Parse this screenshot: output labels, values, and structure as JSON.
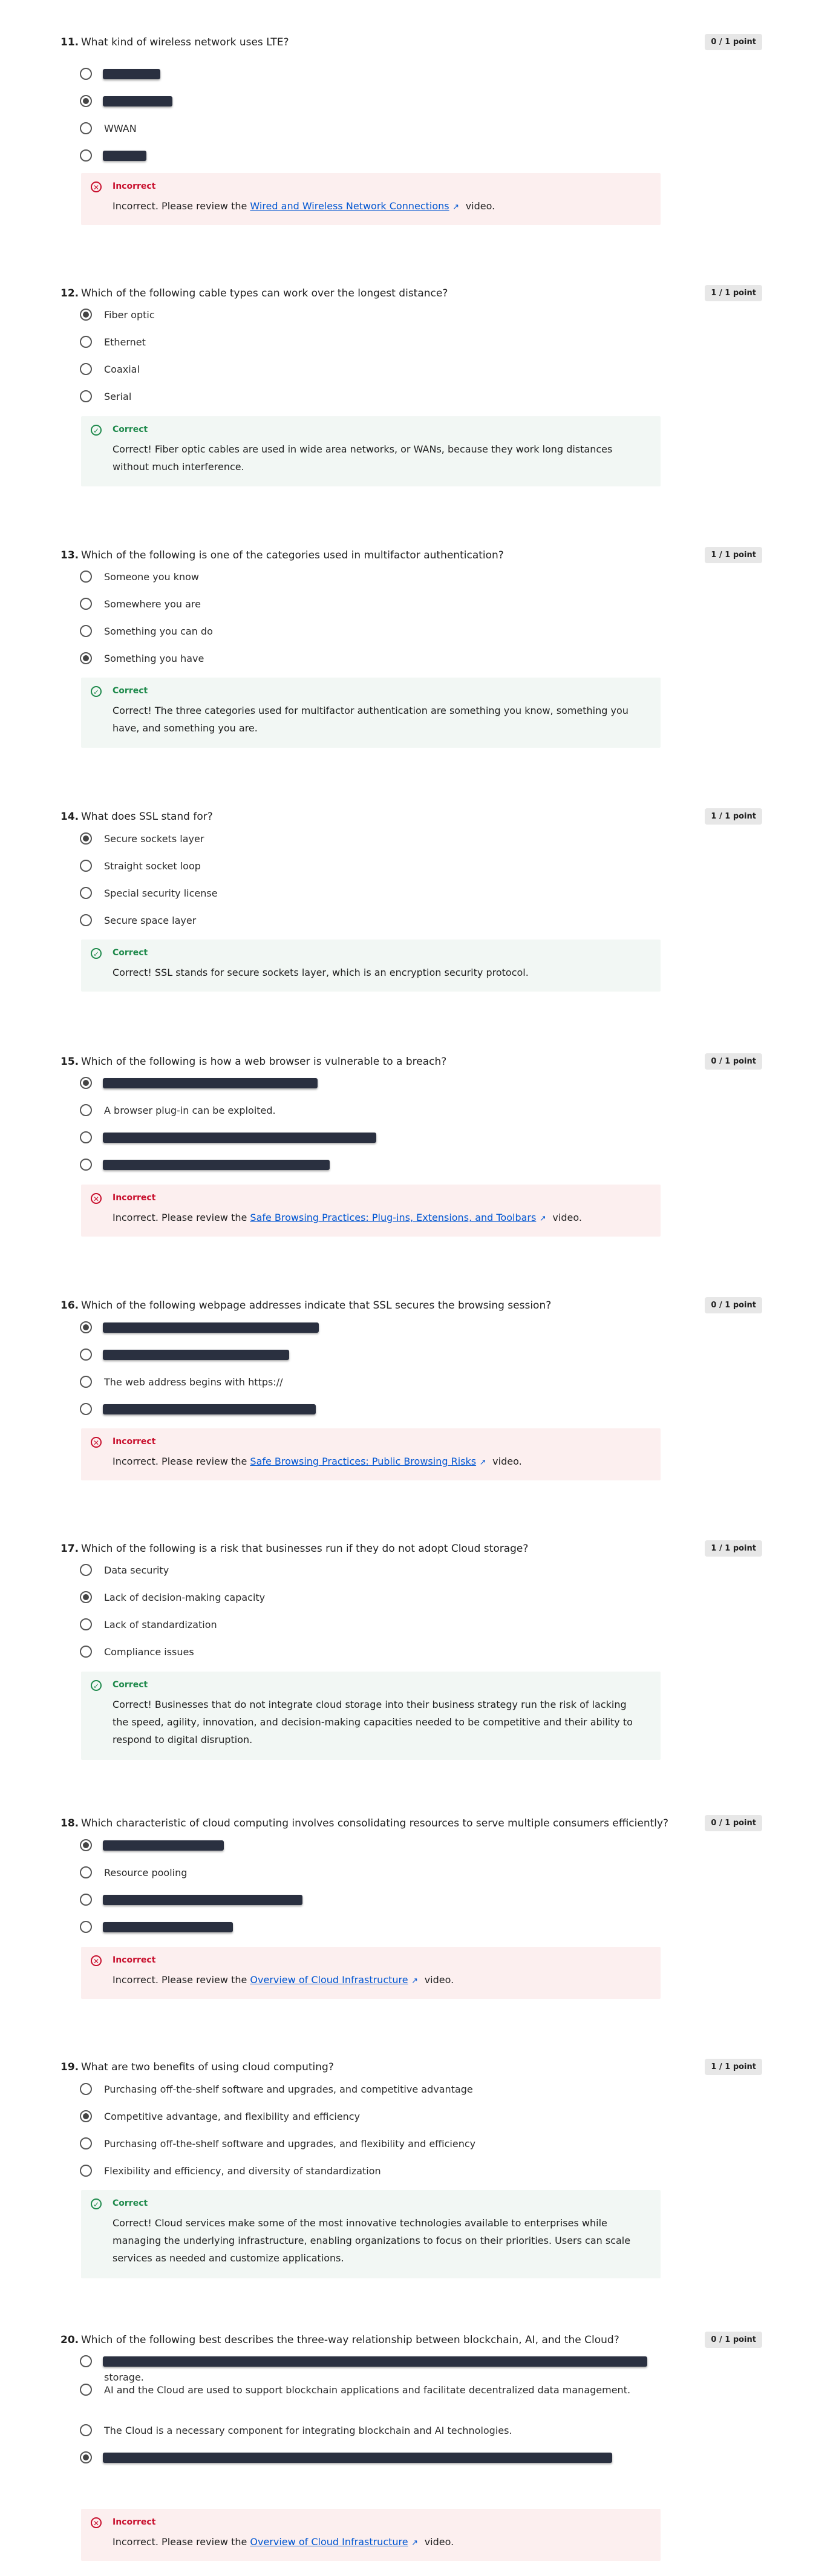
{
  "colors": {
    "incorrect": "#c8102e",
    "correct": "#1f8a4c",
    "link": "#0056d2",
    "score_badge": "#e7e7e7"
  },
  "icons": {
    "incorrect": "x-circle-icon",
    "correct": "check-circle-icon",
    "external": "external-link-icon"
  },
  "questions": [
    {
      "number": "11.",
      "text": "What kind of wireless network uses LTE?",
      "score": "0 / 1 point",
      "options": [
        {
          "text": "",
          "redacted": true,
          "selected": false
        },
        {
          "text": "",
          "redacted": true,
          "selected": true
        },
        {
          "text": "WWAN",
          "redacted": false,
          "selected": false
        },
        {
          "text": "",
          "redacted": true,
          "selected": false
        }
      ],
      "feedback": {
        "status": "Incorrect",
        "before": "Incorrect. Please review the ",
        "link": "Wired and Wireless Network Connections",
        "after": " video.",
        "text": ""
      }
    },
    {
      "number": "12.",
      "text": "Which of the following cable types can work over the longest distance?",
      "score": "1 / 1 point",
      "options": [
        {
          "text": "Fiber optic",
          "redacted": false,
          "selected": true
        },
        {
          "text": "Ethernet",
          "redacted": false,
          "selected": false
        },
        {
          "text": "Coaxial",
          "redacted": false,
          "selected": false
        },
        {
          "text": "Serial",
          "redacted": false,
          "selected": false
        }
      ],
      "feedback": {
        "status": "Correct",
        "text": "Correct! Fiber optic cables are used in wide area networks, or WANs, because they work long distances without much interference."
      }
    },
    {
      "number": "13.",
      "text": "Which of the following is one of the categories used in multifactor authentication?",
      "score": "1 / 1 point",
      "options": [
        {
          "text": "Someone you know",
          "redacted": false,
          "selected": false
        },
        {
          "text": "Somewhere you are",
          "redacted": false,
          "selected": false
        },
        {
          "text": "Something you can do",
          "redacted": false,
          "selected": false
        },
        {
          "text": "Something you have",
          "redacted": false,
          "selected": true
        }
      ],
      "feedback": {
        "status": "Correct",
        "text": "Correct! The three categories used for multifactor authentication are something you know, something you have, and something you are."
      }
    },
    {
      "number": "14.",
      "text": "What does SSL stand for?",
      "score": "1 / 1 point",
      "options": [
        {
          "text": "Secure sockets layer",
          "redacted": false,
          "selected": true
        },
        {
          "text": "Straight socket loop",
          "redacted": false,
          "selected": false
        },
        {
          "text": "Special security license",
          "redacted": false,
          "selected": false
        },
        {
          "text": "Secure space layer",
          "redacted": false,
          "selected": false
        }
      ],
      "feedback": {
        "status": "Correct",
        "text": "Correct! SSL stands for secure sockets layer, which is an encryption security protocol."
      }
    },
    {
      "number": "15.",
      "text": "Which of the following is how a web browser is vulnerable to a breach?",
      "score": "0 / 1 point",
      "options": [
        {
          "text": "",
          "redacted": true,
          "selected": true
        },
        {
          "text": "A browser plug-in can be exploited.",
          "redacted": false,
          "selected": false
        },
        {
          "text": "",
          "redacted": true,
          "selected": false
        },
        {
          "text": "",
          "redacted": true,
          "selected": false
        }
      ],
      "feedback": {
        "status": "Incorrect",
        "before": "Incorrect. Please review the ",
        "link": "Safe Browsing Practices: Plug-ins, Extensions, and Toolbars",
        "after": " video.",
        "text": ""
      }
    },
    {
      "number": "16.",
      "text": "Which of the following webpage addresses indicate that SSL secures the browsing session?",
      "score": "0 / 1 point",
      "options": [
        {
          "text": "",
          "redacted": true,
          "selected": true
        },
        {
          "text": "",
          "redacted": true,
          "selected": false
        },
        {
          "text": "The web address begins with https://",
          "redacted": false,
          "selected": false
        },
        {
          "text": "",
          "redacted": true,
          "selected": false
        }
      ],
      "feedback": {
        "status": "Incorrect",
        "before": "Incorrect. Please review the ",
        "link": "Safe Browsing Practices: Public Browsing Risks",
        "after": " video.",
        "text": ""
      }
    },
    {
      "number": "17.",
      "text": "Which of the following is a risk that businesses run if they do not adopt Cloud storage?",
      "score": "1 / 1 point",
      "options": [
        {
          "text": "Data security",
          "redacted": false,
          "selected": false
        },
        {
          "text": "Lack of decision-making capacity",
          "redacted": false,
          "selected": true
        },
        {
          "text": "Lack of standardization",
          "redacted": false,
          "selected": false
        },
        {
          "text": "Compliance issues",
          "redacted": false,
          "selected": false
        }
      ],
      "feedback": {
        "status": "Correct",
        "text": "Correct! Businesses that do not integrate cloud storage into their business strategy run the risk of lacking the speed, agility, innovation, and decision-making capacities needed to be competitive and their ability to respond to digital disruption."
      }
    },
    {
      "number": "18.",
      "text": "Which characteristic of cloud computing involves consolidating resources to serve multiple consumers efficiently?",
      "score": "0 / 1 point",
      "options": [
        {
          "text": "",
          "redacted": true,
          "selected": true
        },
        {
          "text": "Resource pooling",
          "redacted": false,
          "selected": false
        },
        {
          "text": "",
          "redacted": true,
          "selected": false
        },
        {
          "text": "",
          "redacted": true,
          "selected": false
        }
      ],
      "feedback": {
        "status": "Incorrect",
        "before": "Incorrect. Please review the ",
        "link": "Overview of Cloud Infrastructure",
        "after": " video.",
        "text": ""
      }
    },
    {
      "number": "19.",
      "text": "What are two benefits of using cloud computing?",
      "score": "1 / 1 point",
      "options": [
        {
          "text": "Purchasing off-the-shelf software and upgrades, and competitive advantage",
          "redacted": false,
          "selected": false
        },
        {
          "text": "Competitive advantage, and flexibility and efficiency",
          "redacted": false,
          "selected": true
        },
        {
          "text": "Purchasing off-the-shelf software and upgrades, and flexibility and efficiency",
          "redacted": false,
          "selected": false
        },
        {
          "text": "Flexibility and efficiency, and diversity of standardization",
          "redacted": false,
          "selected": false
        }
      ],
      "feedback": {
        "status": "Correct",
        "text": "Correct! Cloud services make some of the most innovative technologies available to enterprises while managing the underlying infrastructure, enabling organizations to focus on their priorities. Users can scale services as needed and customize applications."
      }
    },
    {
      "number": "20.",
      "text": "Which of the following best describes the three-way relationship between blockchain, AI, and the Cloud?",
      "score": "0 / 1 point",
      "options": [
        {
          "text": "storage.",
          "redacted": true,
          "selected": false
        },
        {
          "text": "AI and the Cloud are used to support blockchain applications and facilitate decentralized data management.",
          "redacted": false,
          "selected": false
        },
        {
          "text": "The Cloud is a necessary component for integrating blockchain and AI technologies.",
          "redacted": false,
          "selected": false
        },
        {
          "text": "",
          "redacted": true,
          "selected": true
        }
      ],
      "feedback": {
        "status": "Incorrect",
        "before": "Incorrect. Please review the ",
        "link": "Overview of Cloud Infrastructure",
        "after": " video.",
        "text": ""
      }
    }
  ]
}
